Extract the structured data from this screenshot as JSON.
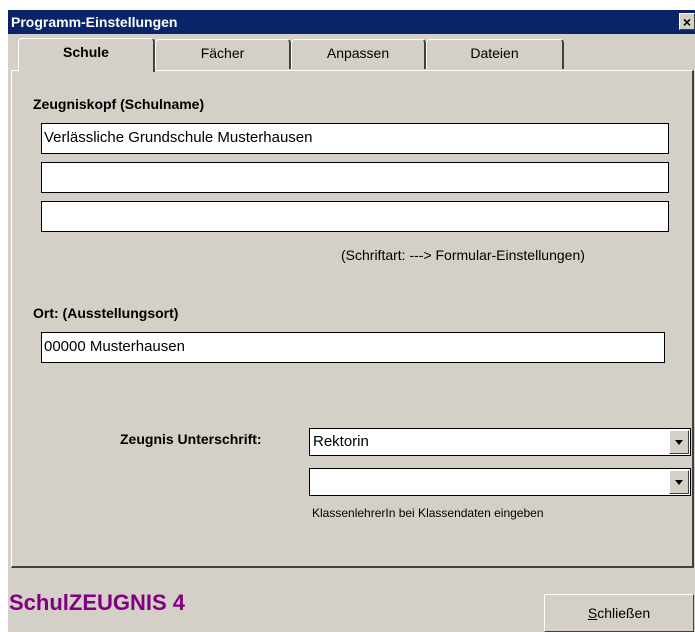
{
  "window": {
    "title": "Programm-Einstellungen",
    "close_label": "×"
  },
  "tabs": [
    {
      "label": "Schule",
      "active": true
    },
    {
      "label": "Fächer",
      "active": false
    },
    {
      "label": "Anpassen",
      "active": false
    },
    {
      "label": "Dateien",
      "active": false
    }
  ],
  "school": {
    "heading": "Zeugniskopf (Schulname)",
    "lines": [
      "Verlässliche Grundschule Musterhausen",
      "",
      ""
    ],
    "font_hint": "(Schriftart: ---> Formular-Einstellungen)"
  },
  "location": {
    "heading": "Ort: (Ausstellungsort)",
    "value": "00000 Musterhausen"
  },
  "signature": {
    "label": "Zeugnis Unterschrift:",
    "first_value": "Rektorin",
    "second_value": "",
    "hint": "KlassenlehrerIn bei Klassendaten eingeben"
  },
  "footer": {
    "brand": "SchulZEUGNIS 4",
    "close_button_mnemonic": "S",
    "close_button_rest": "chließen"
  }
}
